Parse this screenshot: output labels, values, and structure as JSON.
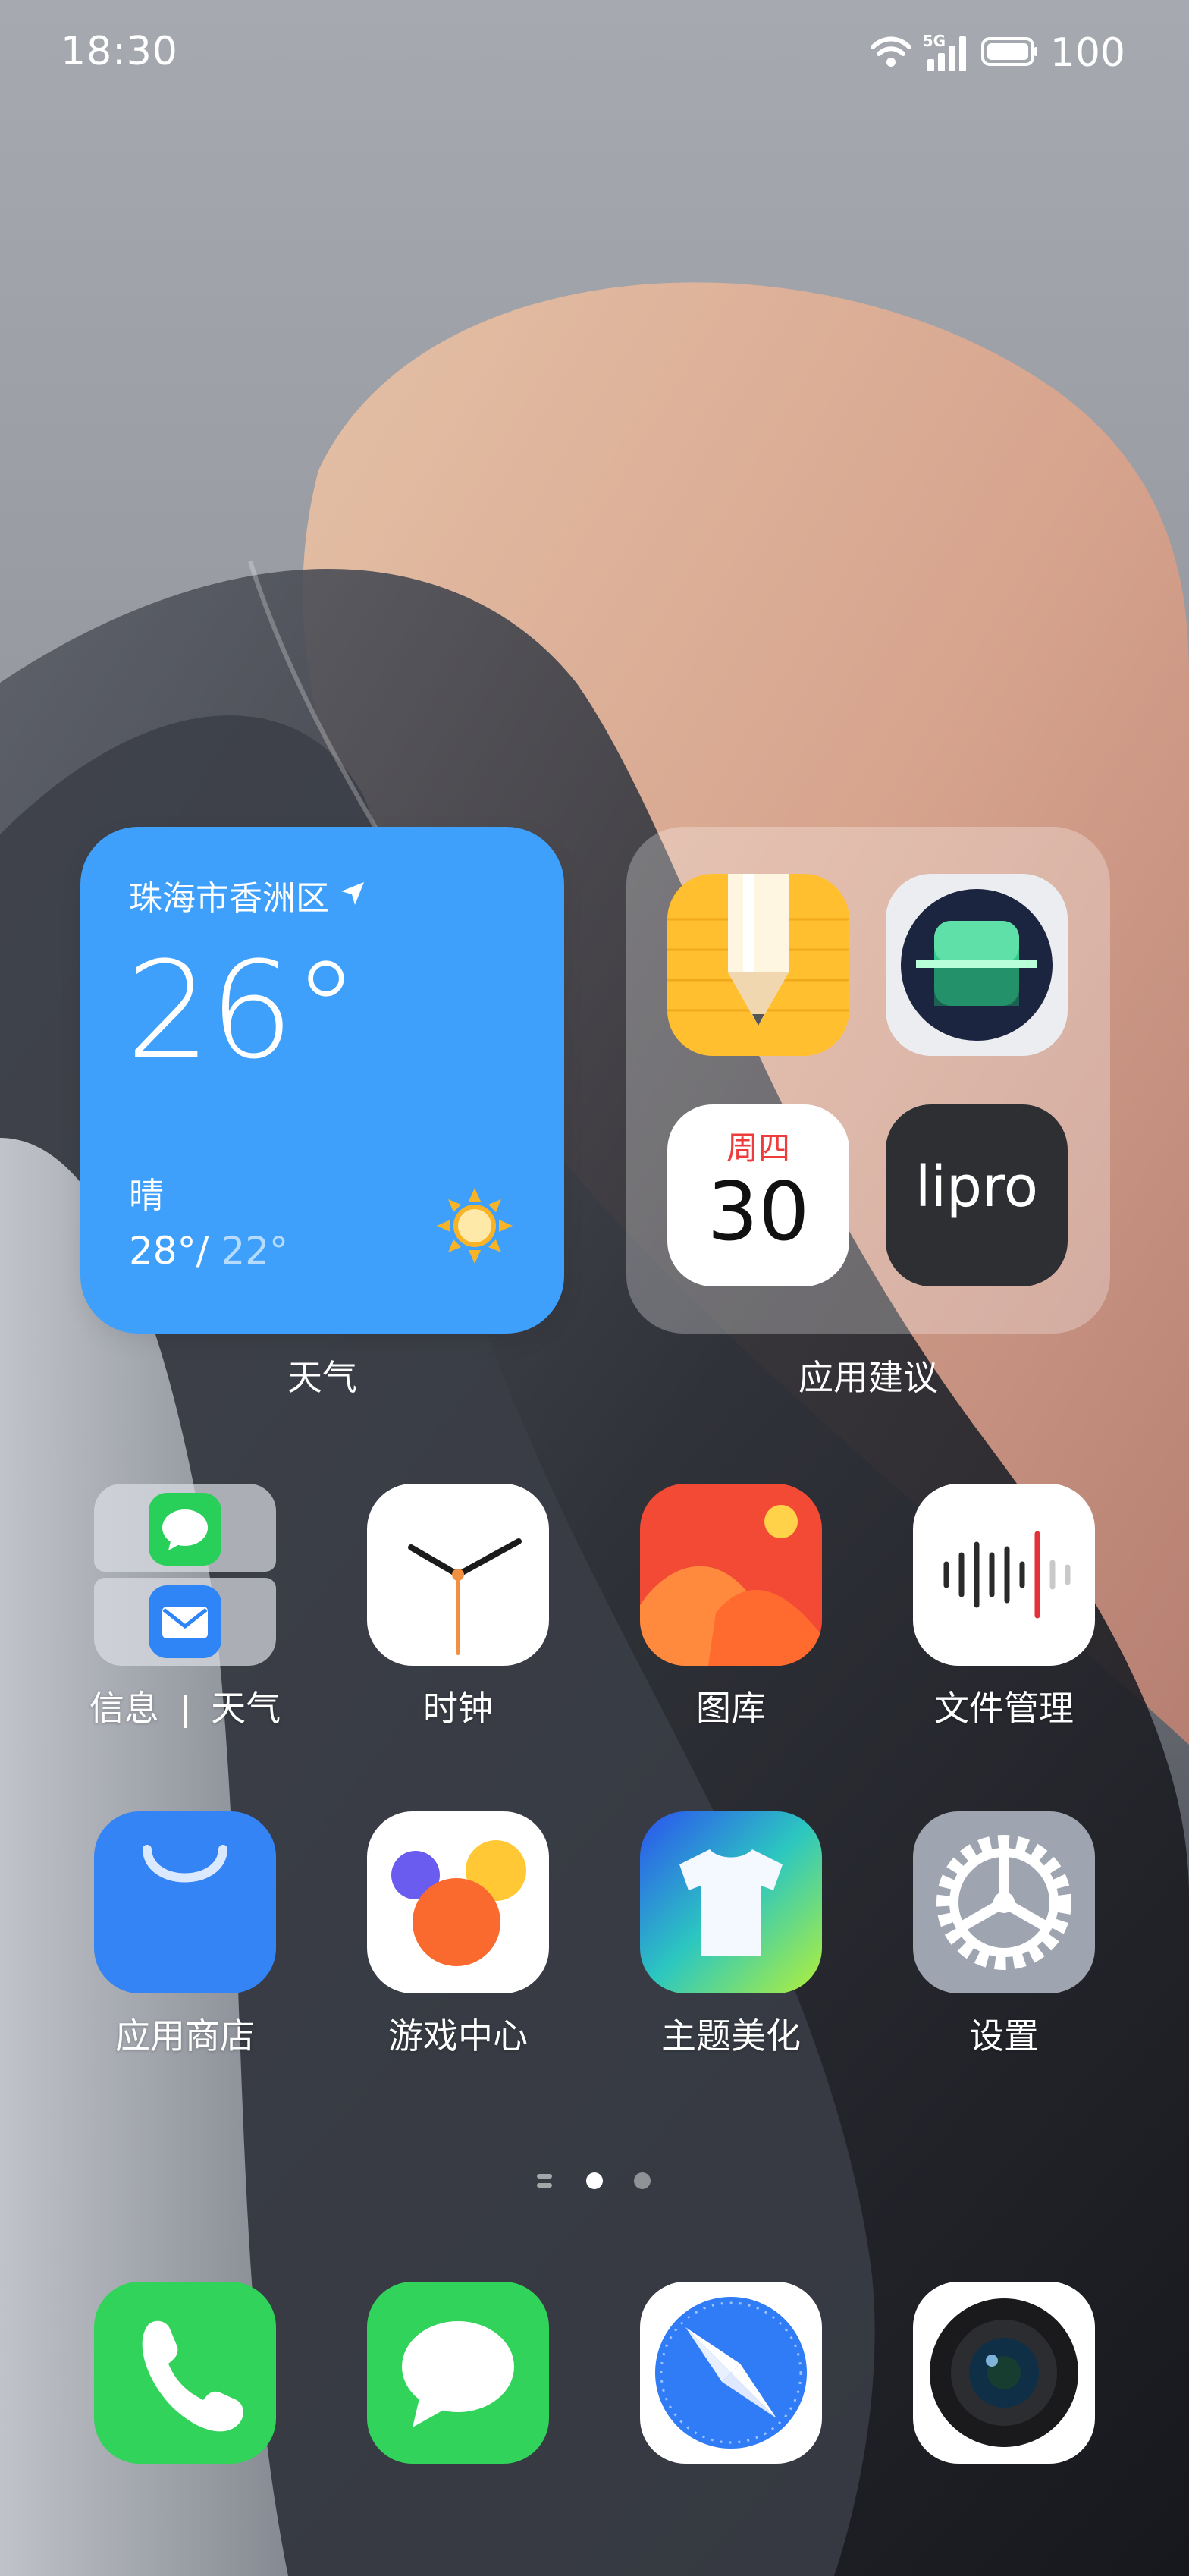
{
  "status_bar": {
    "time": "18:30",
    "network": "5G",
    "battery": "100",
    "icons": [
      "wifi-icon",
      "signal-5g-icon",
      "battery-icon"
    ]
  },
  "weather_widget": {
    "location": "珠海市香洲区",
    "temperature": "26°",
    "condition": "晴",
    "high": "28°",
    "separator": "/",
    "low": "22°",
    "label": "天气",
    "color": "#3fa0fb"
  },
  "suggestions_widget": {
    "label": "应用建议",
    "apps": [
      {
        "icon": "notes-icon"
      },
      {
        "icon": "scanner-icon"
      },
      {
        "icon": "calendar-icon",
        "weekday": "周四",
        "day": "30"
      },
      {
        "icon": "lipro-icon",
        "text": "lipro"
      }
    ]
  },
  "apps": [
    {
      "label_a": "信息",
      "label_b": "天气",
      "icon": "messages-weather-pair-icon"
    },
    {
      "label": "时钟",
      "icon": "clock-icon"
    },
    {
      "label": "图库",
      "icon": "gallery-icon"
    },
    {
      "label": "文件管理",
      "icon": "file-manager-icon"
    },
    {
      "label": "应用商店",
      "icon": "app-store-icon"
    },
    {
      "label": "游戏中心",
      "icon": "game-center-icon"
    },
    {
      "label": "主题美化",
      "icon": "themes-icon"
    },
    {
      "label": "设置",
      "icon": "settings-icon"
    }
  ],
  "page_indicator": {
    "pages": 2,
    "current": 1
  },
  "dock": [
    {
      "icon": "phone-icon"
    },
    {
      "icon": "messages-icon"
    },
    {
      "icon": "browser-icon"
    },
    {
      "icon": "camera-icon"
    }
  ]
}
